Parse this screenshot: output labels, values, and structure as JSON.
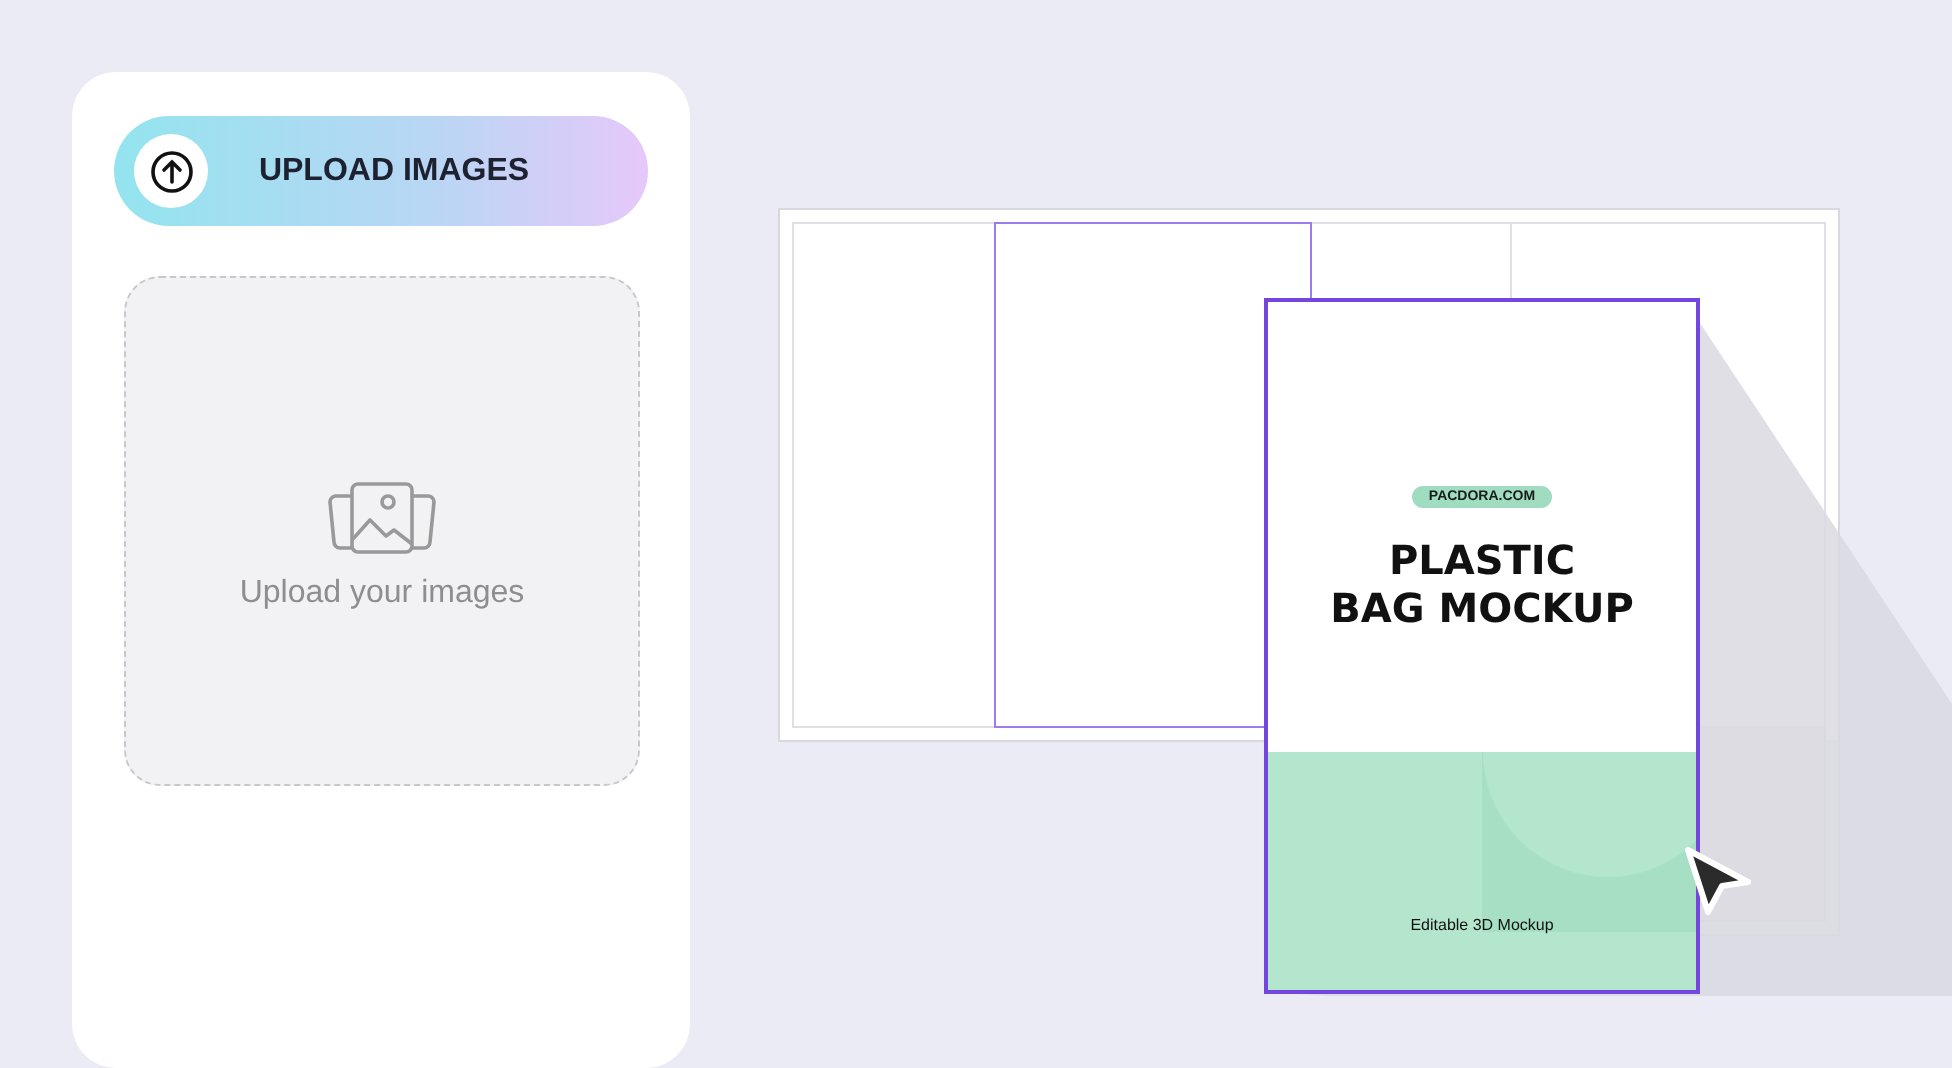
{
  "upload_panel": {
    "upload_button": {
      "label": "UPLOAD IMAGES"
    },
    "dropzone": {
      "text": "Upload your images"
    }
  },
  "canvas": {
    "mockup": {
      "badge": "PACDORA.COM",
      "title_lines": [
        "PLASTIC",
        "BAG MOCKUP"
      ],
      "subtitle": "Editable 3D Mockup"
    }
  }
}
